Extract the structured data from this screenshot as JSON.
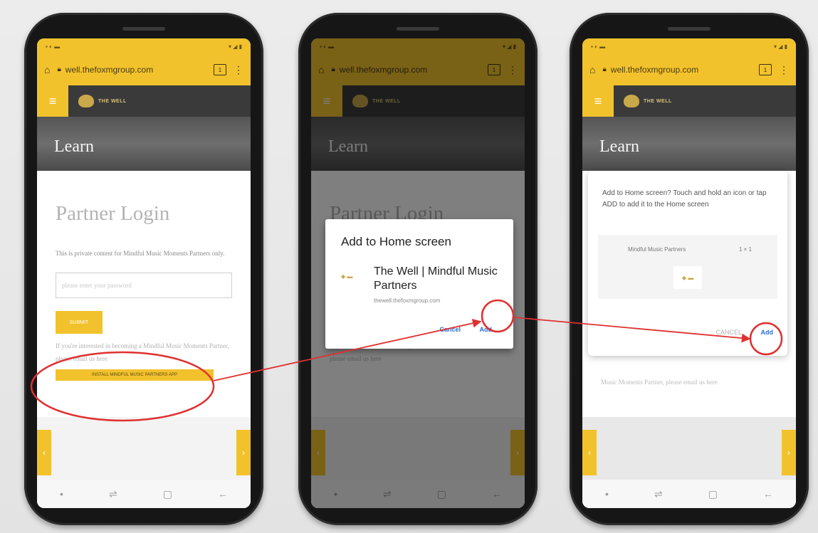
{
  "colors": {
    "accent": "#f2c22c",
    "header": "#3a3a3a",
    "annotation": "#e03030",
    "link": "#2a6fd0"
  },
  "browser": {
    "url": "well.thefoxmgroup.com",
    "tab_count": "1"
  },
  "site": {
    "logo_text": "THE WELL",
    "hero_title": "Learn"
  },
  "phone1": {
    "title": "Partner Login",
    "description": "This is private content for Mindful Music Moments Partners only.",
    "password_placeholder": "please enter your password",
    "submit_label": "SUBMIT",
    "notice": "If you're interested in becoming a Mindful Music Moments Partner, please email us here",
    "cta_label": "INSTALL MINDFUL MUSIC PARTNERS APP"
  },
  "phone2": {
    "dialog_title": "Add to Home screen",
    "app_name": "The Well | Mindful Music Partners",
    "app_url": "thewell.thefoxmgroup.com",
    "cancel_label": "Cancel",
    "add_label": "Add"
  },
  "phone3": {
    "sheet_text": "Add to Home screen? Touch and hold an icon or tap ADD to add it to the Home screen",
    "preview_name": "Mindful Music Partners",
    "preview_count": "1 × 1",
    "cancel_label": "CANCEL",
    "add_label": "Add",
    "behind_text": "Music Moments Partner, please email us here"
  },
  "icons": {
    "home": "home-icon",
    "lock": "lock-icon",
    "tabs": "tabs-icon",
    "more": "more-vert-icon",
    "menu": "hamburger-icon",
    "recent": "recent-apps-icon",
    "overview": "square-icon",
    "back": "back-arrow-icon",
    "chevron_left": "chevron-left-icon",
    "chevron_right": "chevron-right-icon"
  }
}
